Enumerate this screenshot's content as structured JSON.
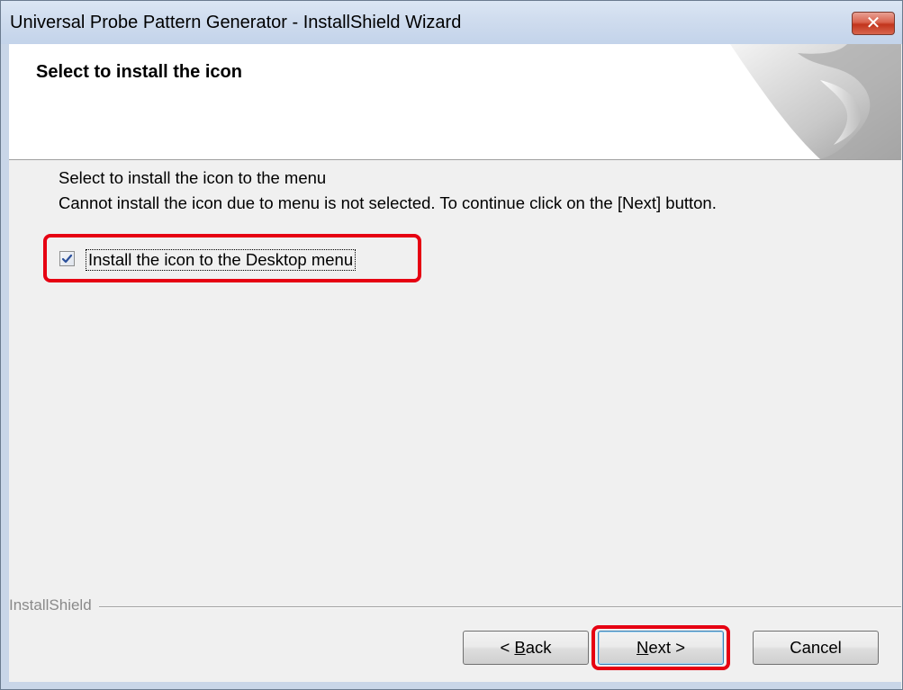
{
  "window": {
    "title": "Universal Probe Pattern Generator - InstallShield Wizard",
    "close_glyph": "✕"
  },
  "header": {
    "title": "Select to install the icon"
  },
  "body": {
    "line1": "Select to install the icon to the menu",
    "line2": "Cannot install the icon due to menu is not selected. To continue click on the [Next] button.",
    "checkbox_label": "Install the icon to the Desktop menu",
    "checkbox_checked": true
  },
  "footer": {
    "brand": "InstallShield",
    "back_prefix": "< ",
    "back_mnemonic": "B",
    "back_rest": "ack",
    "next_mnemonic": "N",
    "next_rest": "ext >",
    "cancel_label": "Cancel"
  },
  "colors": {
    "highlight": "#e60012",
    "titlebar": "#cfdcee",
    "face": "#f0f0f0"
  },
  "icons": {
    "close": "close-icon",
    "check": "checkmark-icon",
    "header_art": "page-curl-graphic"
  }
}
